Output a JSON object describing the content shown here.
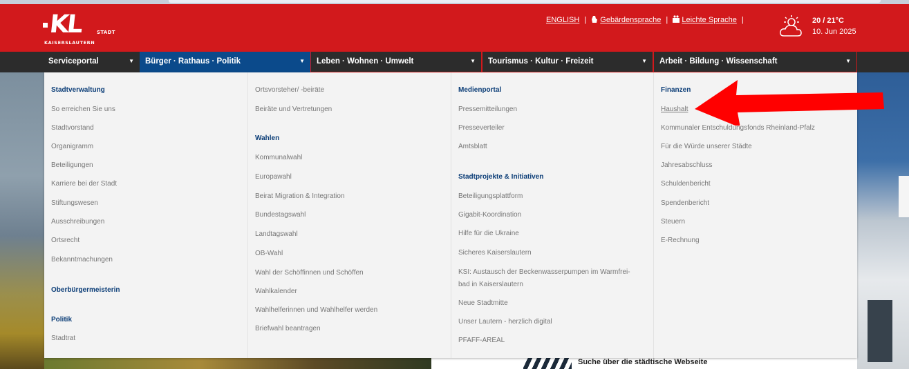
{
  "header": {
    "logo": {
      "brand": "KL",
      "stadt": "STADT",
      "city": "KAISERSLAUTERN"
    },
    "links": [
      {
        "label": "ENGLISH",
        "icon": ""
      },
      {
        "label": "Gebärdensprache",
        "icon": "sign-language-icon"
      },
      {
        "label": "Leichte Sprache",
        "icon": "easy-language-icon"
      }
    ],
    "separator": "|",
    "weather": {
      "icon": "sun-cloud-icon",
      "temp": "20 / 21°C",
      "date": "10. Jun 2025"
    }
  },
  "nav": {
    "tabs": [
      {
        "label": "Serviceportal"
      },
      {
        "label": "Bürger · Rathaus · Politik"
      },
      {
        "label": "Leben · Wohnen · Umwelt"
      },
      {
        "label": "Tourismus · Kultur · Freizeit"
      },
      {
        "label": "Arbeit · Bildung · Wissenschaft"
      }
    ],
    "chevron": "▼"
  },
  "menu": {
    "col1": {
      "h1": "Stadtverwaltung",
      "items": [
        "So erreichen Sie uns",
        "Stadtvorstand",
        "Organigramm",
        "Beteiligungen",
        "Karriere bei der Stadt",
        "Stiftungswesen",
        "Ausschreibungen",
        "Ortsrecht",
        "Bekanntmachungen"
      ],
      "h2": "Oberbürgermeisterin",
      "h3": "Politik",
      "politik_items": [
        "Stadtrat"
      ]
    },
    "col2": {
      "top_items": [
        "Ortsvorsteher/ -beiräte",
        "Beiräte und Vertretungen"
      ],
      "h1": "Wahlen",
      "items": [
        "Kommunalwahl",
        "Europawahl",
        "Beirat Migration & Integration",
        "Bundestagswahl",
        "Landtagswahl",
        "OB-Wahl",
        "Wahl der Schöffinnen und Schöffen",
        "Wahlkalender",
        "Wahlhelferinnen und Wahlhelfer werden",
        "Briefwahl beantragen"
      ]
    },
    "col3": {
      "h1": "Medienportal",
      "items": [
        "Pressemitteilungen",
        "Presseverteiler",
        "Amtsblatt"
      ],
      "h2": "Stadtprojekte & Initiativen",
      "projects": [
        "Beteiligungsplattform",
        "Gigabit-Koordination",
        "Hilfe für die Ukraine",
        "Sicheres Kaiserslautern",
        "KSI: Austausch der Beckenwasserpumpen im Warmfrei-",
        "bad in Kaiserslautern",
        "Neue Stadtmitte",
        "Unser Lautern - herzlich digital",
        "PFAFF-AREAL"
      ]
    },
    "col4": {
      "h1": "Finanzen",
      "items": [
        "Haushalt",
        "Kommunaler Entschuldungsfonds Rheinland-Pfalz",
        "Für die Würde unserer Städte",
        "Jahresabschluss",
        "Schuldenbericht",
        "Spendenbericht",
        "Steuern",
        "E-Rechnung"
      ]
    }
  },
  "search_label": "Suche über die städtische Webseite",
  "colors": {
    "brand_red": "#d2191c",
    "nav_dark": "#2c2c2c",
    "active_blue": "#0b4a8b",
    "heading_blue": "#0b3d77",
    "arrow_red": "#ff0000"
  }
}
